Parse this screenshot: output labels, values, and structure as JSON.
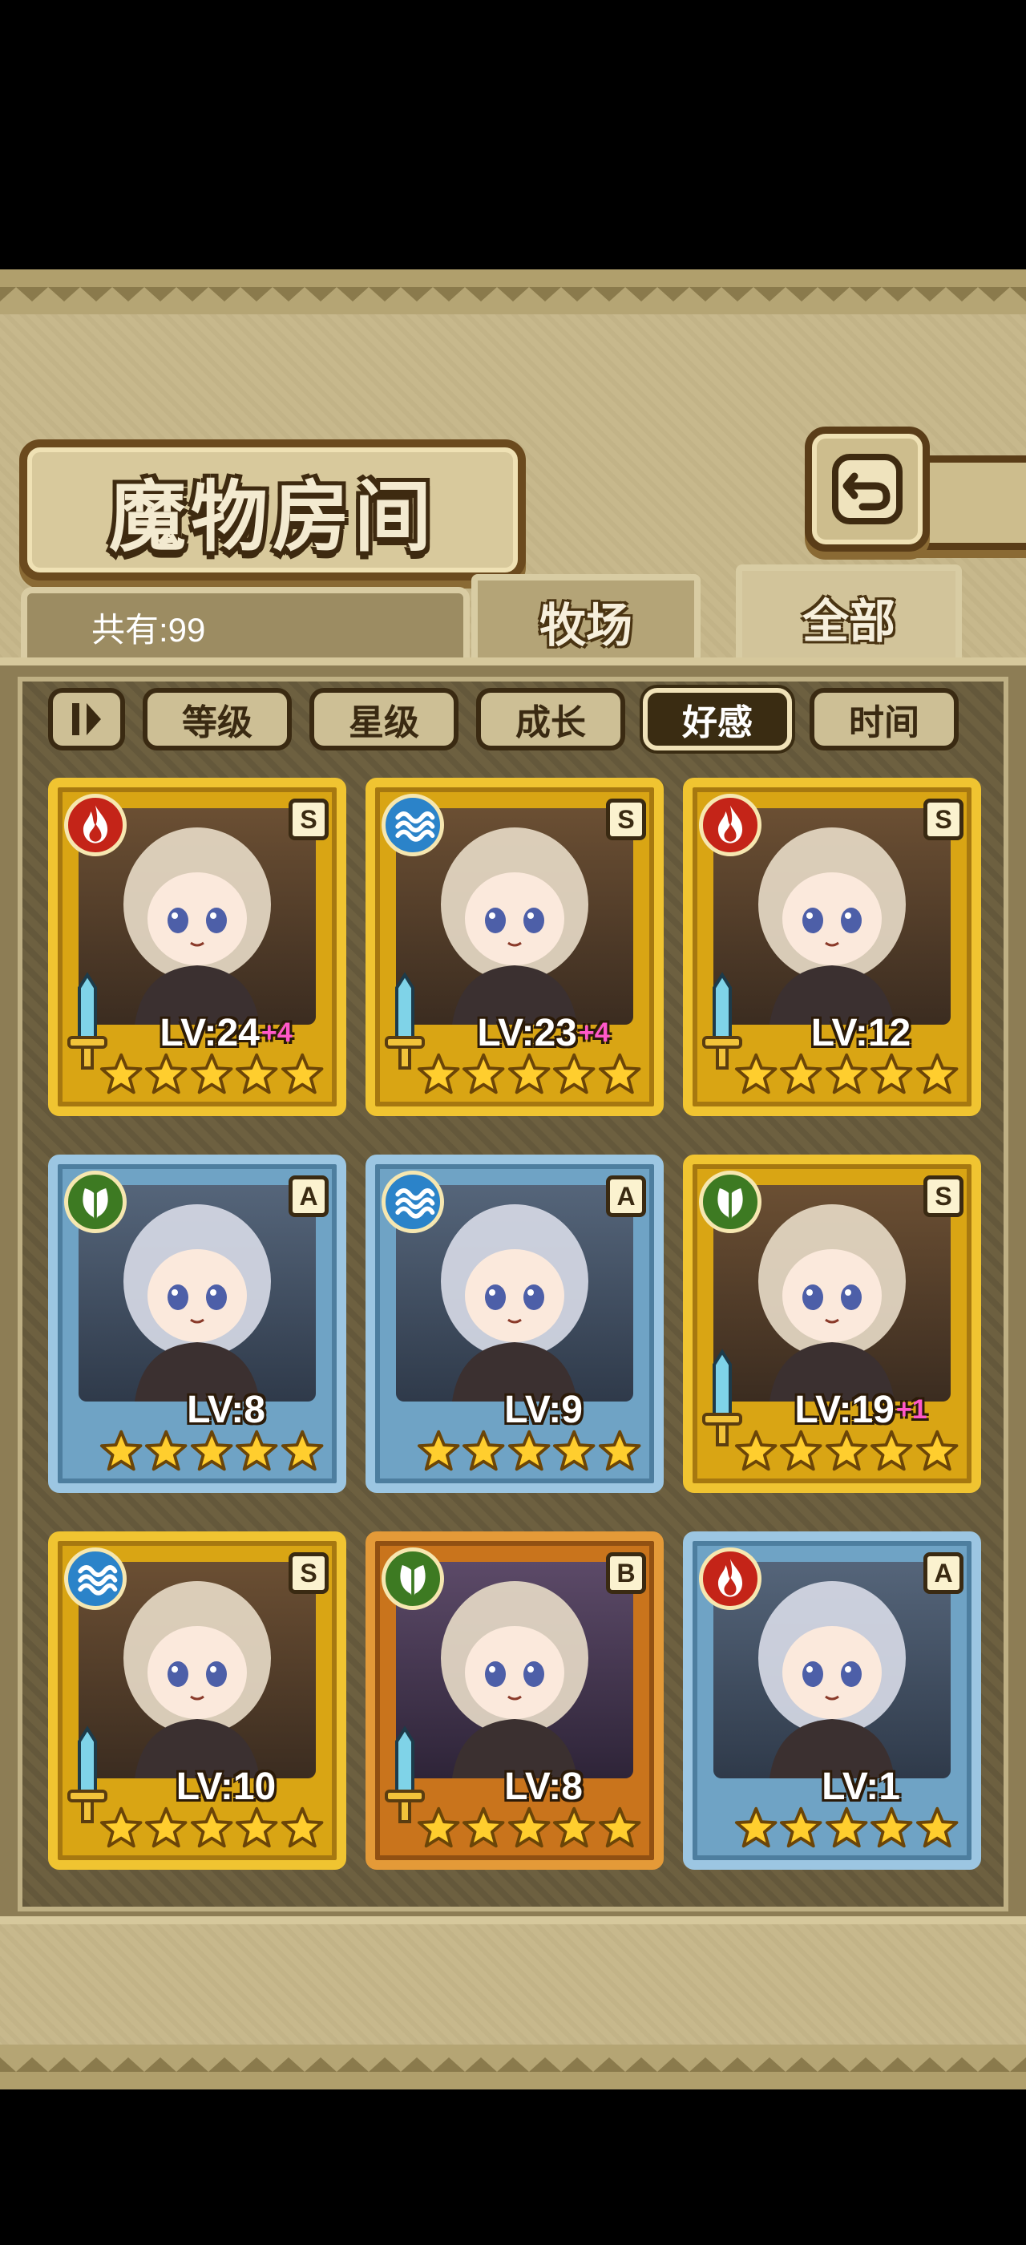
{
  "title": "魔物房间",
  "header": {
    "count_label": "共有:99",
    "tabs": [
      {
        "label": "牧场",
        "active": false
      },
      {
        "label": "全部",
        "active": true
      }
    ]
  },
  "sort": {
    "toggle_icon": "sort-direction-icon",
    "buttons": [
      {
        "label": "等级",
        "active": false
      },
      {
        "label": "星级",
        "active": false
      },
      {
        "label": "成长",
        "active": false
      },
      {
        "label": "好感",
        "active": true
      },
      {
        "label": "时间",
        "active": false
      }
    ]
  },
  "monsters": [
    {
      "element": "fire",
      "rank": "S",
      "level": "LV:24",
      "plus": "+4",
      "frame": "gold",
      "stars": 5
    },
    {
      "element": "water",
      "rank": "S",
      "level": "LV:23",
      "plus": "+4",
      "frame": "gold",
      "stars": 5
    },
    {
      "element": "fire",
      "rank": "S",
      "level": "LV:12",
      "plus": "",
      "frame": "gold",
      "stars": 5
    },
    {
      "element": "leaf",
      "rank": "A",
      "level": "LV:8",
      "plus": "",
      "frame": "blue",
      "stars": 5
    },
    {
      "element": "water",
      "rank": "A",
      "level": "LV:9",
      "plus": "",
      "frame": "blue",
      "stars": 5
    },
    {
      "element": "leaf",
      "rank": "S",
      "level": "LV:19",
      "plus": "+1",
      "frame": "gold",
      "stars": 5
    },
    {
      "element": "water",
      "rank": "S",
      "level": "LV:10",
      "plus": "",
      "frame": "gold",
      "stars": 5
    },
    {
      "element": "leaf",
      "rank": "B",
      "level": "LV:8",
      "plus": "",
      "frame": "bronze",
      "stars": 5
    },
    {
      "element": "fire",
      "rank": "A",
      "level": "LV:1",
      "plus": "",
      "frame": "blue",
      "stars": 5
    }
  ],
  "colors": {
    "fire": "#c42418",
    "water": "#2b83c9",
    "leaf": "#3d7a22",
    "frame_gold": "#f0c431",
    "frame_blue": "#9cc6e2",
    "frame_bronze": "#e49a38",
    "plus_text": "#ff58c8"
  }
}
